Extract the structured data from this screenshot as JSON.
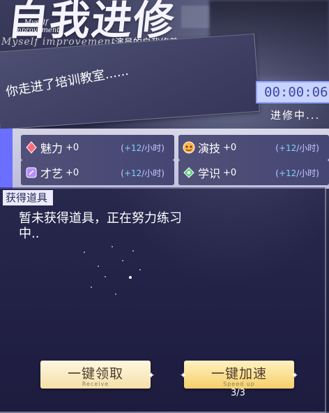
{
  "header": {
    "title_cn": "自我进修",
    "title_en_line1": "Myself",
    "title_en_line2": "improvement",
    "title_script": "Myself improvement",
    "subtitle": "-演员的自我修养"
  },
  "scene": {
    "message": "你走进了培训教室......"
  },
  "timer": {
    "time": "00:00:06",
    "status": "进修中..."
  },
  "stats": [
    {
      "name": "魅力",
      "value": "+0",
      "rate": "+12",
      "unit": "/小时)",
      "icon": "diamond-icon",
      "color": "#ff6b7a"
    },
    {
      "name": "演技",
      "value": "+0",
      "rate": "+12",
      "unit": "/小时)",
      "icon": "mask-icon",
      "color": "#ffb347"
    },
    {
      "name": "才艺",
      "value": "+0",
      "rate": "+12",
      "unit": "/小时)",
      "icon": "guitar-icon",
      "color": "#b88cff"
    },
    {
      "name": "学识",
      "value": "+0",
      "rate": "+12",
      "unit": "/小时)",
      "icon": "graduation-cap-icon",
      "color": "#5ad27a"
    }
  ],
  "items": {
    "label": "获得道具",
    "empty_text": "暂未获得道具，正在努力练习中.."
  },
  "buttons": {
    "receive_label": "一键领取",
    "receive_sub": "Receive",
    "speed_label": "一键加速",
    "speed_sub": "Speed up",
    "speed_count": "3/3"
  }
}
